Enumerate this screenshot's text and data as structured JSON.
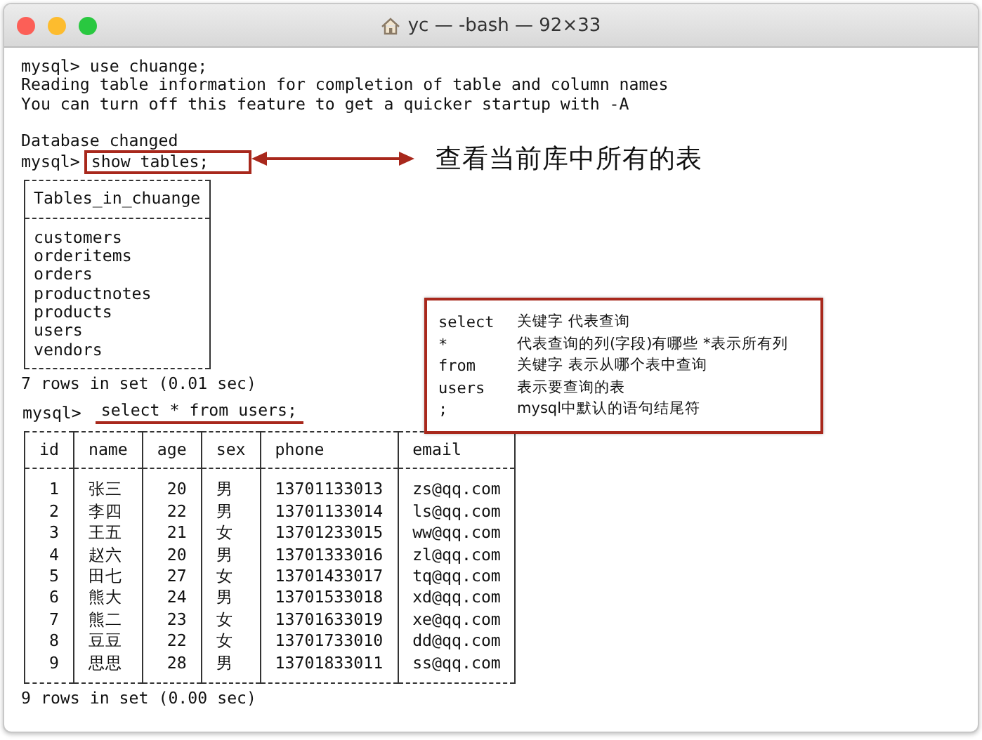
{
  "window": {
    "title": "yc — -bash — 92×33"
  },
  "session": [
    {
      "kind": "line",
      "text": "mysql> use chuange;"
    },
    {
      "kind": "line",
      "text": "Reading table information for completion of table and column names"
    },
    {
      "kind": "line",
      "text": "You can turn off this feature to get a quicker startup with -A"
    },
    {
      "kind": "blank"
    },
    {
      "kind": "line",
      "text": "Database changed"
    },
    {
      "kind": "command",
      "prompt": "mysql>",
      "command": "show tables;",
      "boxed": true,
      "underlined": false
    },
    {
      "kind": "table",
      "columns": [
        {
          "label": "Tables_in_chuange",
          "right_aligned": false
        }
      ],
      "rows": [
        [
          "customers"
        ],
        [
          "orderitems"
        ],
        [
          "orders"
        ],
        [
          "productnotes"
        ],
        [
          "products"
        ],
        [
          "users"
        ],
        [
          "vendors"
        ]
      ]
    },
    {
      "kind": "line",
      "text": "7 rows in set (0.01 sec)"
    },
    {
      "kind": "command",
      "prompt": "mysql>",
      "command": "select * from users;",
      "boxed": false,
      "underlined": true
    },
    {
      "kind": "table",
      "columns": [
        {
          "label": "id",
          "right_aligned": true
        },
        {
          "label": "name",
          "right_aligned": false
        },
        {
          "label": "age",
          "right_aligned": true
        },
        {
          "label": "sex",
          "right_aligned": false
        },
        {
          "label": "phone"
        },
        {
          "label": "email"
        }
      ],
      "rows": [
        [
          "1",
          "张三",
          "20",
          "男",
          "13701133013",
          "zs@qq.com"
        ],
        [
          "2",
          "李四",
          "22",
          "男",
          "13701133014",
          "ls@qq.com"
        ],
        [
          "3",
          "王五",
          "21",
          "女",
          "13701233015",
          "ww@qq.com"
        ],
        [
          "4",
          "赵六",
          "20",
          "男",
          "13701333016",
          "zl@qq.com"
        ],
        [
          "5",
          "田七",
          "27",
          "女",
          "13701433017",
          "tq@qq.com"
        ],
        [
          "6",
          "熊大",
          "24",
          "男",
          "13701533018",
          "xd@qq.com"
        ],
        [
          "7",
          "熊二",
          "23",
          "女",
          "13701633019",
          "xe@qq.com"
        ],
        [
          "8",
          "豆豆",
          "22",
          "女",
          "13701733010",
          "dd@qq.com"
        ],
        [
          "9",
          "思思",
          "28",
          "男",
          "13701833011",
          "ss@qq.com"
        ]
      ]
    },
    {
      "kind": "line",
      "text": "9 rows in set (0.00 sec)"
    }
  ],
  "annotations": {
    "arrow_label": "查看当前库中所有的表",
    "note": [
      {
        "term": "select",
        "description": "关键字 代表查询"
      },
      {
        "term": "*",
        "description": "代表查询的列(字段)有哪些 *表示所有列"
      },
      {
        "term": "from",
        "description": "关键字 表示从哪个表中查询"
      },
      {
        "term": "users",
        "description": "表示要查询的表"
      },
      {
        "term": ";",
        "description": "mysql中默认的语句结尾符"
      }
    ]
  }
}
